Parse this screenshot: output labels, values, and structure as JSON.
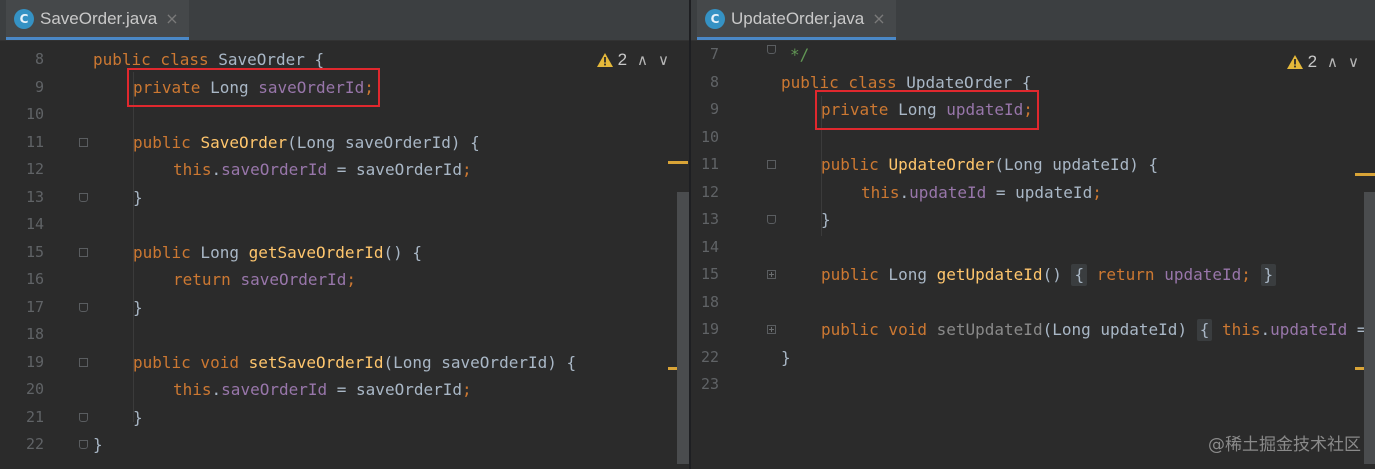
{
  "left": {
    "tab": {
      "icon": "C",
      "name": "SaveOrder.java",
      "close": "×"
    },
    "inspection": {
      "warn_icon": "⚠",
      "count": "2",
      "up": "∧",
      "down": "∨"
    },
    "lines": [
      {
        "n": "8",
        "t": [
          "public class SaveOrder {"
        ]
      },
      {
        "n": "9",
        "t": [
          "private Long saveOrderId;"
        ]
      },
      {
        "n": "10",
        "t": [
          ""
        ]
      },
      {
        "n": "11",
        "t": [
          "public SaveOrder(Long saveOrderId) {"
        ]
      },
      {
        "n": "12",
        "t": [
          "this.saveOrderId = saveOrderId;"
        ]
      },
      {
        "n": "13",
        "t": [
          "}"
        ]
      },
      {
        "n": "14",
        "t": [
          ""
        ]
      },
      {
        "n": "15",
        "t": [
          "public Long getSaveOrderId() {"
        ]
      },
      {
        "n": "16",
        "t": [
          "return saveOrderId;"
        ]
      },
      {
        "n": "17",
        "t": [
          "}"
        ]
      },
      {
        "n": "18",
        "t": [
          ""
        ]
      },
      {
        "n": "19",
        "t": [
          "public void setSaveOrderId(Long saveOrderId) {"
        ]
      },
      {
        "n": "20",
        "t": [
          "this.saveOrderId = saveOrderId;"
        ]
      },
      {
        "n": "21",
        "t": [
          "}"
        ]
      },
      {
        "n": "22",
        "t": [
          "}"
        ]
      }
    ]
  },
  "right": {
    "tab": {
      "icon": "C",
      "name": "UpdateOrder.java",
      "close": "×"
    },
    "inspection": {
      "warn_icon": "⚠",
      "count": "2",
      "up": "∧",
      "down": "∨"
    },
    "lines": [
      {
        "n": "7",
        "t": [
          "*/"
        ]
      },
      {
        "n": "8",
        "t": [
          "public class UpdateOrder {"
        ]
      },
      {
        "n": "9",
        "t": [
          "private Long updateId;"
        ]
      },
      {
        "n": "10",
        "t": [
          ""
        ]
      },
      {
        "n": "11",
        "t": [
          "public UpdateOrder(Long updateId) {"
        ]
      },
      {
        "n": "12",
        "t": [
          "this.updateId = updateId;"
        ]
      },
      {
        "n": "13",
        "t": [
          "}"
        ]
      },
      {
        "n": "14",
        "t": [
          ""
        ]
      },
      {
        "n": "15",
        "t": [
          "public Long getUpdateId() { return updateId; }"
        ]
      },
      {
        "n": "18",
        "t": [
          ""
        ]
      },
      {
        "n": "19",
        "t": [
          "public void setUpdateId(Long updateId) { this.updateId ="
        ]
      },
      {
        "n": "22",
        "t": [
          "}"
        ]
      },
      {
        "n": "23",
        "t": [
          ""
        ]
      }
    ]
  },
  "watermark": "@稀土掘金技术社区",
  "colors": {
    "keyword": "#cc7832",
    "field": "#9876aa",
    "method": "#ffc66d",
    "comment": "#629755",
    "text": "#a9b7c6",
    "highlight_box": "#e0282e",
    "warning": "#e5b93a"
  }
}
